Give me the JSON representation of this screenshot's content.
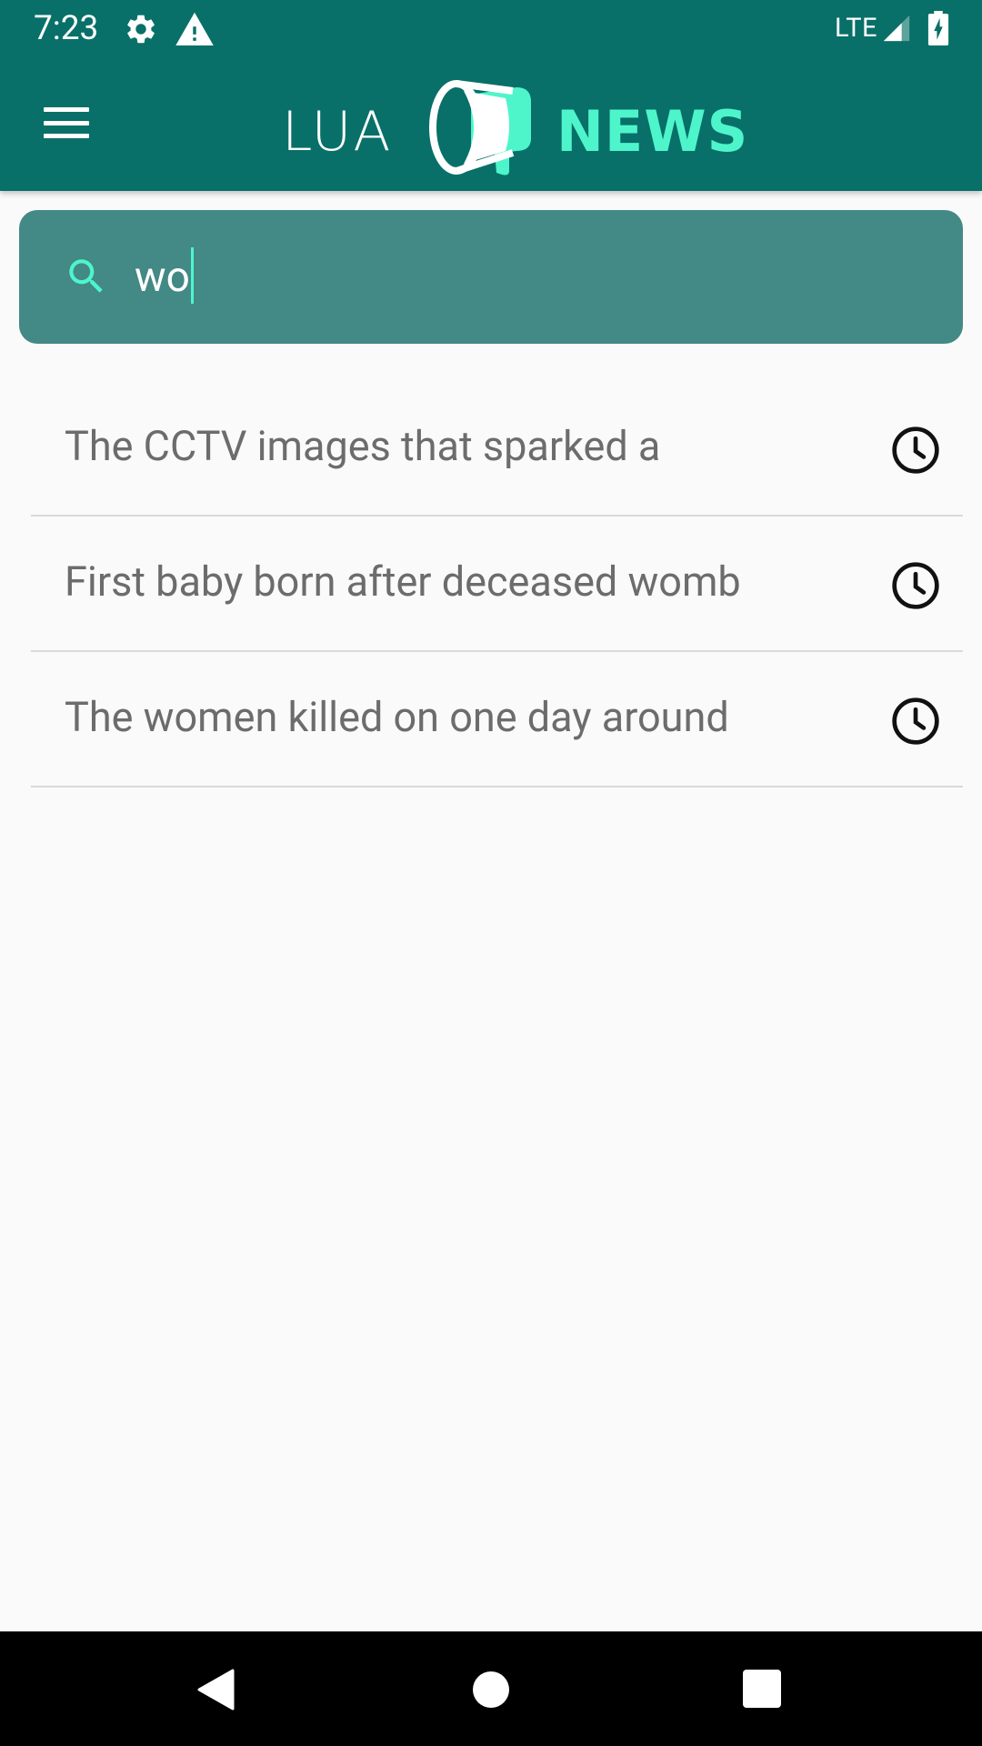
{
  "status_bar": {
    "time": "7:23",
    "network": "LTE",
    "icons": [
      "gear-icon",
      "warning-icon",
      "signal-icon",
      "battery-charging-icon"
    ]
  },
  "app_bar": {
    "menu_icon": "hamburger-menu-icon",
    "logo": {
      "word_left": "LUA",
      "word_right": "NEWS",
      "icon": "megaphone-icon"
    }
  },
  "search": {
    "icon": "search-icon",
    "value": "wo"
  },
  "suggestions": [
    {
      "text": "The CCTV images that sparked a",
      "icon": "history-clock-icon"
    },
    {
      "text": "First baby born after deceased womb",
      "icon": "history-clock-icon"
    },
    {
      "text": "The women killed on one day around",
      "icon": "history-clock-icon"
    }
  ],
  "navigation_bar": {
    "buttons": [
      "back-icon",
      "home-icon",
      "recents-icon"
    ]
  },
  "colors": {
    "app_bar": "#087068",
    "search_bar": "#438985",
    "accent": "#4ef5cb",
    "suggestion_text": "#6c6c6c",
    "background": "#fafafa"
  }
}
